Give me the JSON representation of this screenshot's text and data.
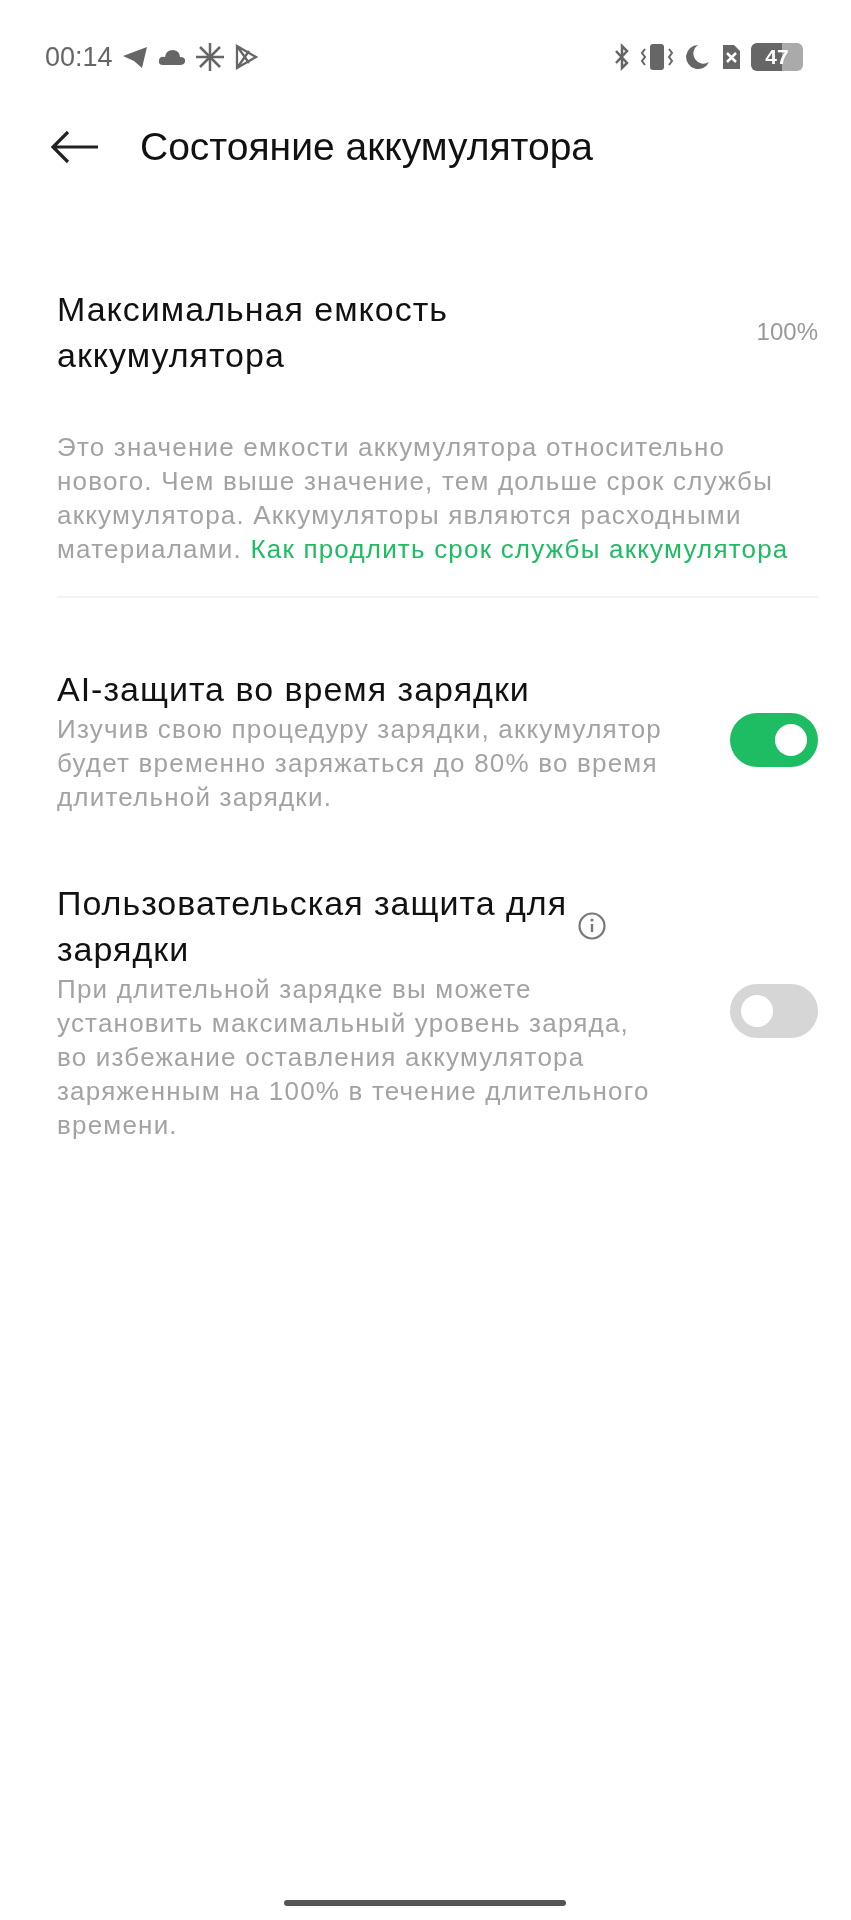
{
  "status_bar": {
    "time": "00:14",
    "battery": "47"
  },
  "header": {
    "title": "Состояние аккумулятора"
  },
  "items": [
    {
      "kind": "value",
      "title": "Максимальная емкость аккумулятора",
      "value": "100%",
      "description": "Это значение емкости аккумулятора относительно нового. Чем выше значение, тем дольше срок службы аккумулятора. Аккумуляторы являются расходными материалами.",
      "link": "Как продлить срок службы аккумулятора"
    },
    {
      "kind": "toggle",
      "title": "AI-защита во время зарядки",
      "description": "Изучив свою процедуру зарядки, аккумулятор будет временно заряжаться до 80% во время длительной зарядки.",
      "on": true,
      "info": false
    },
    {
      "kind": "toggle",
      "title": "Пользовательская защита для зарядки",
      "description": "При длительной зарядке вы можете установить максимальный уровень заряда, во избежание оставления аккумулятора заряженным на 100% в течение длительного времени.",
      "on": false,
      "info": true
    }
  ]
}
